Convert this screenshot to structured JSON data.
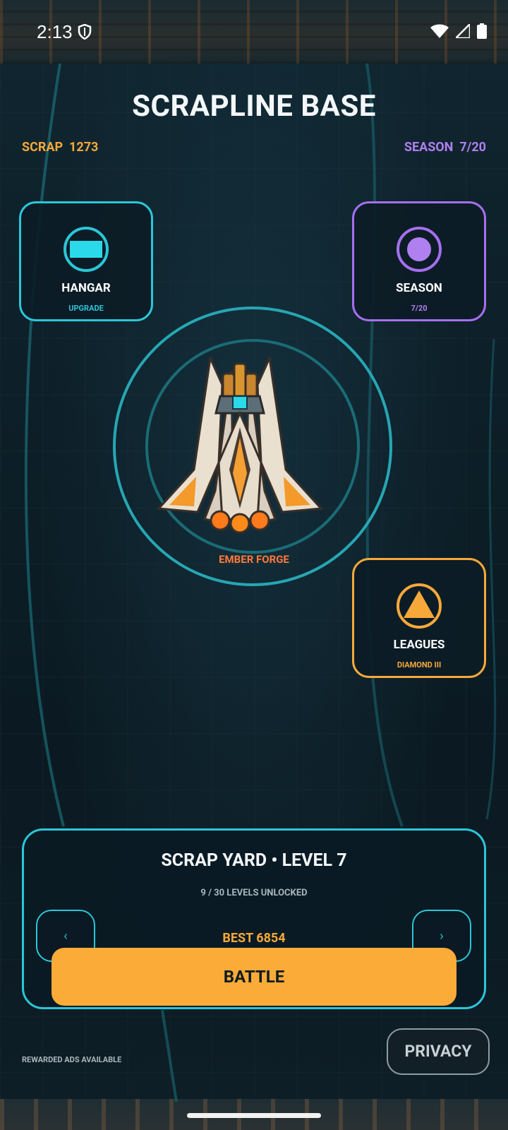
{
  "status_bar": {
    "time": "2:13"
  },
  "header": {
    "title": "SCRAPLINE BASE"
  },
  "resources": {
    "scrap_label": "SCRAP  1273",
    "season_label": "SEASON  7/20"
  },
  "tiles": {
    "hangar": {
      "label": "HANGAR",
      "sub": "UPGRADE",
      "icon": "rectangle-icon"
    },
    "season": {
      "label": "SEASON",
      "sub": "7/20",
      "icon": "circle-dot-icon"
    },
    "leagues": {
      "label": "LEAGUES",
      "sub": "DIAMOND III",
      "icon": "triangle-icon"
    }
  },
  "ship": {
    "name": "EMBER FORGE"
  },
  "level_panel": {
    "title": "SCRAP YARD  •  LEVEL 7",
    "unlocked": "9 / 30 LEVELS UNLOCKED",
    "best": "BEST 6854",
    "prev": "‹",
    "next": "›",
    "battle": "BATTLE"
  },
  "footer": {
    "ads": "REWARDED ADS AVAILABLE",
    "privacy": "PRIVACY"
  },
  "colors": {
    "cyan": "#2bc6d8",
    "purple": "#a66ff0",
    "orange": "#f6a93a"
  }
}
